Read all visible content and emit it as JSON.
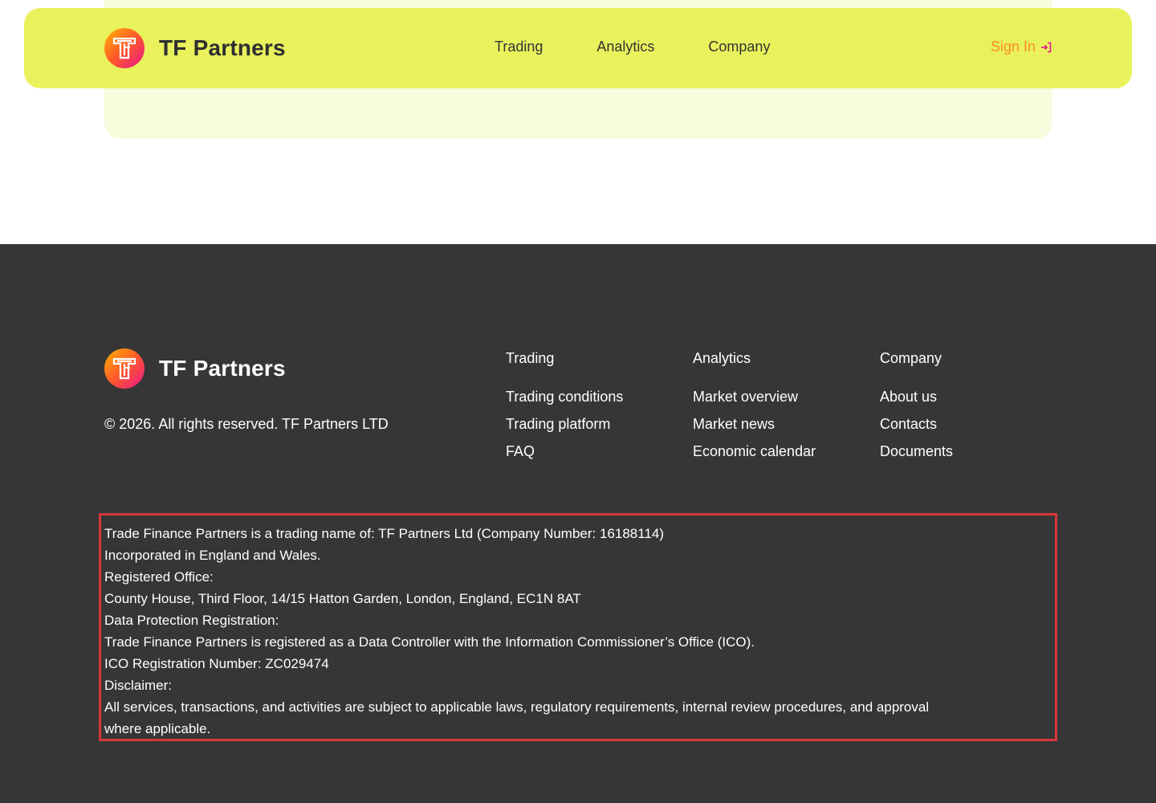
{
  "brand": {
    "name": "TF Partners"
  },
  "header": {
    "nav": [
      "Trading",
      "Analytics",
      "Company"
    ],
    "signin_label": "Sign In"
  },
  "footer": {
    "copyright": "© 2026. All rights reserved. TF Partners LTD",
    "columns": [
      {
        "heading": "Trading",
        "links": [
          "Trading conditions",
          "Trading platform",
          "FAQ"
        ]
      },
      {
        "heading": "Analytics",
        "links": [
          "Market overview",
          "Market news",
          "Economic calendar"
        ]
      },
      {
        "heading": "Company",
        "links": [
          "About us",
          "Contacts",
          "Documents"
        ]
      }
    ],
    "legal": [
      "Trade Finance Partners is a trading name of: TF Partners Ltd (Company Number: 16188114)",
      "Incorporated in England and Wales.",
      "Registered Office:",
      "County House, Third Floor, 14/15 Hatton Garden, London, England, EC1N 8AT",
      "Data Protection Registration:",
      "Trade Finance Partners is registered as a Data Controller with the Information Commissioner’s Office (ICO).",
      "ICO Registration Number: ZC029474",
      "Disclaimer:",
      "All services, transactions, and activities are subject to applicable laws, regulatory requirements, internal review procedures, and approval",
      "where applicable."
    ]
  },
  "colors": {
    "header_bg": "#e9f25c",
    "footer_bg": "#363636",
    "accent_orange": "#ff8a1f",
    "legal_border": "#d9363b"
  },
  "icons": {
    "logo": "tf-logo-icon",
    "signin": "sign-in-arrow-icon"
  }
}
